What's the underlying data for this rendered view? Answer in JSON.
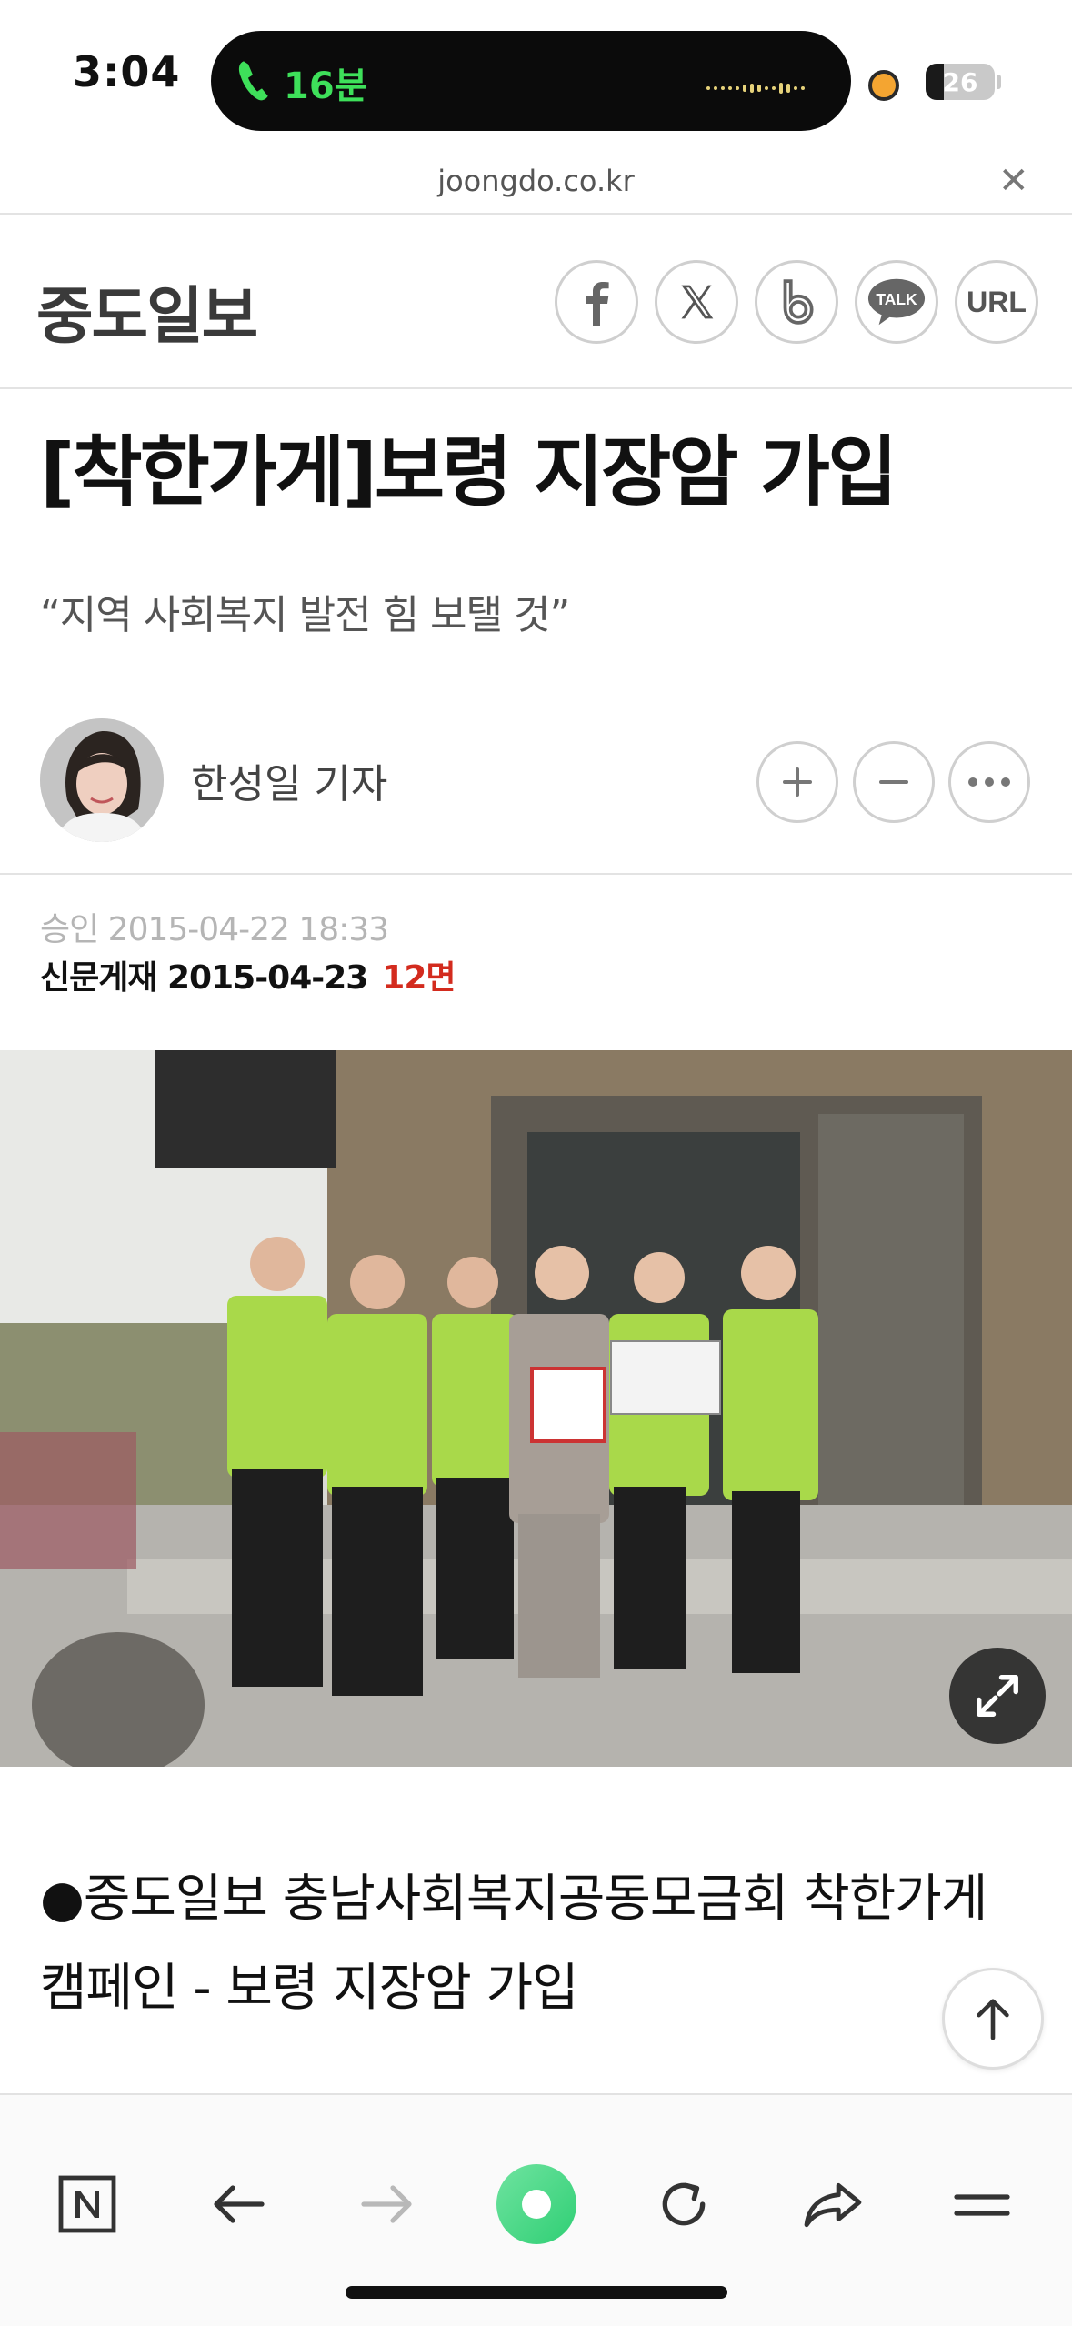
{
  "status_bar": {
    "time": "3:04",
    "call_duration": "16분",
    "battery_level": "26"
  },
  "browser": {
    "url": "joongdo.co.kr",
    "close_icon": "close-icon"
  },
  "header": {
    "logo_text": "중도일보",
    "share_buttons": [
      "facebook-icon",
      "x-icon",
      "band-icon",
      "kakaotalk-icon",
      "url-icon"
    ],
    "url_label": "URL",
    "talk_label": "TALK"
  },
  "article": {
    "headline": "[착한가게]보령 지장암 가입",
    "subtitle": "“지역 사회복지 발전 힘 보탤 것”",
    "author": "한성일 기자",
    "approved_label": "승인 2015-04-22 18:33",
    "print_label": "신문게재 2015-04-23",
    "print_page": "12면",
    "lead": "●중도일보 충남사회복지공동모금회 착한가게 캠페인 - 보령 지장암 가입"
  },
  "colors": {
    "call_green": "#3ee05a",
    "page_red": "#d32b1e",
    "accent_green": "#41d98a"
  },
  "toolbar": {
    "items": [
      "naver-home-icon",
      "back-icon",
      "forward-icon",
      "green-dot-icon",
      "reload-icon",
      "share-icon",
      "menu-icon"
    ]
  }
}
